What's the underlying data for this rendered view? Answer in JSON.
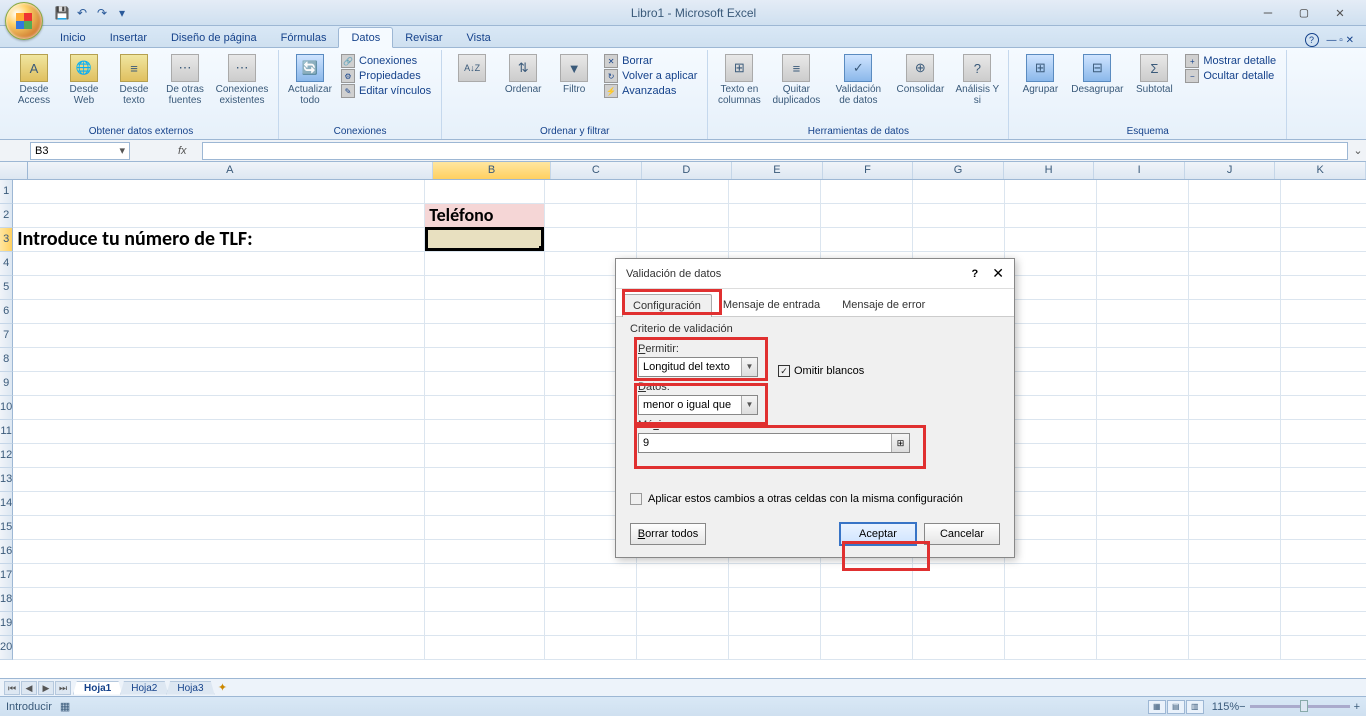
{
  "titlebar": {
    "title": "Libro1 - Microsoft Excel"
  },
  "ribbon_tabs": [
    "Inicio",
    "Insertar",
    "Diseño de página",
    "Fórmulas",
    "Datos",
    "Revisar",
    "Vista"
  ],
  "active_tab_index": 4,
  "ribbon": {
    "g1": {
      "label": "Obtener datos externos",
      "items": [
        "Desde Access",
        "Desde Web",
        "Desde texto",
        "De otras fuentes",
        "Conexiones existentes"
      ]
    },
    "g2": {
      "label": "Conexiones",
      "big": "Actualizar todo",
      "items": [
        "Conexiones",
        "Propiedades",
        "Editar vínculos"
      ]
    },
    "g3": {
      "label": "Ordenar y filtrar",
      "big1": "Ordenar",
      "big2": "Filtro",
      "items": [
        "Borrar",
        "Volver a aplicar",
        "Avanzadas"
      ]
    },
    "g4": {
      "label": "Herramientas de datos",
      "items": [
        "Texto en columnas",
        "Quitar duplicados",
        "Validación de datos",
        "Consolidar",
        "Análisis Y si"
      ]
    },
    "g5": {
      "label": "Esquema",
      "items": [
        "Agrupar",
        "Desagrupar",
        "Subtotal"
      ],
      "side": [
        "Mostrar detalle",
        "Ocultar detalle"
      ]
    }
  },
  "namebox": "B3",
  "columns": [
    "A",
    "B",
    "C",
    "D",
    "E",
    "F",
    "G",
    "H",
    "I",
    "J",
    "K"
  ],
  "rows_count": 20,
  "cells": {
    "B2": "Teléfono",
    "A3": "Introduce tu número de TLF:"
  },
  "sheets": {
    "active": "Hoja1",
    "tabs": [
      "Hoja1",
      "Hoja2",
      "Hoja3"
    ]
  },
  "status": {
    "mode": "Introducir",
    "zoom": "115%"
  },
  "dialog": {
    "title": "Validación de datos",
    "tabs": [
      "Configuración",
      "Mensaje de entrada",
      "Mensaje de error"
    ],
    "fieldset": "Criterio de validación",
    "permitir_label": "Permitir:",
    "permitir_value": "Longitud del texto",
    "omitir": "Omitir blancos",
    "datos_label": "Datos:",
    "datos_value": "menor o igual que",
    "maximo_label": "Máximo:",
    "maximo_value": "9",
    "apply": "Aplicar estos cambios a otras celdas con la misma configuración",
    "btn_clear": "Borrar todos",
    "btn_ok": "Aceptar",
    "btn_cancel": "Cancelar"
  }
}
